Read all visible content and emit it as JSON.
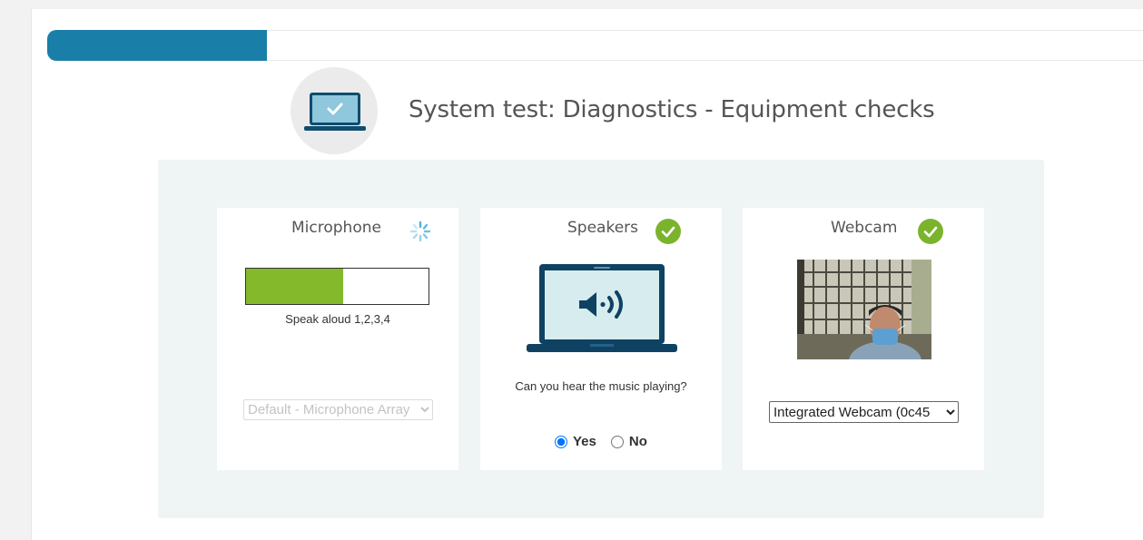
{
  "progress": {
    "percent": 20
  },
  "header": {
    "title": "System test: Diagnostics - Equipment checks",
    "icon": "laptop-check-icon"
  },
  "colors": {
    "accent": "#1a7fa8",
    "success": "#7cb32d",
    "level": "#83b92a",
    "panel": "#eef5f4",
    "loading": "#4fb1d9"
  },
  "microphone": {
    "title": "Microphone",
    "status": "loading",
    "status_icon": "spinner-icon",
    "level_percent": 53,
    "hint": "Speak aloud 1,2,3,4",
    "device_selected": "Default - Microphone Array"
  },
  "speakers": {
    "title": "Speakers",
    "status": "ok",
    "status_icon": "check-icon",
    "illustration": "laptop-speaker-icon",
    "question": "Can you hear the music playing?",
    "options": [
      "Yes",
      "No"
    ],
    "selected": "Yes"
  },
  "webcam": {
    "title": "Webcam",
    "status": "ok",
    "status_icon": "check-icon",
    "device_selected": "Integrated Webcam (0c45"
  }
}
